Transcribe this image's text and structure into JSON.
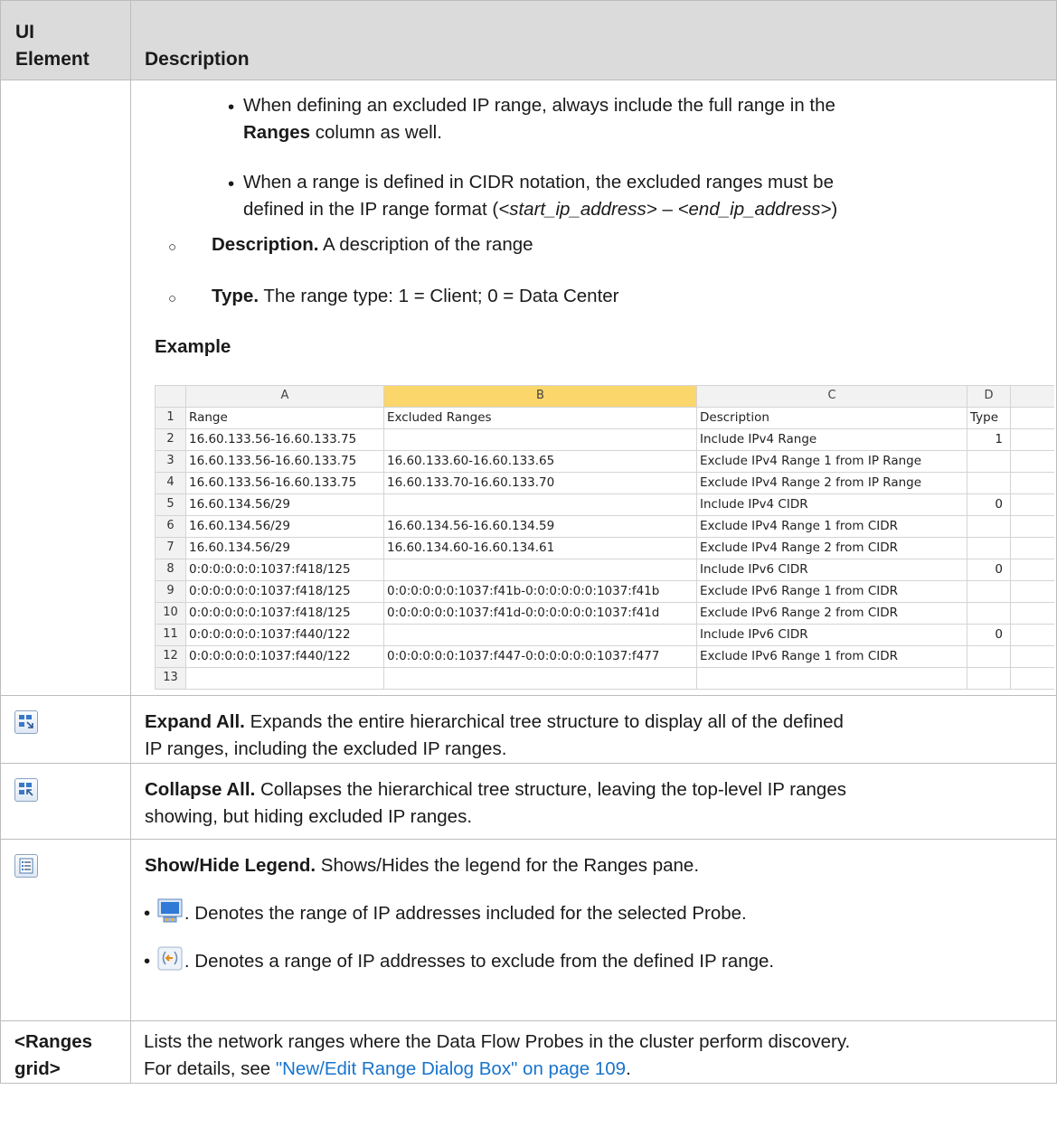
{
  "header": {
    "col1_line1": "UI",
    "col1_line2": "Element",
    "col2": "Description"
  },
  "row1": {
    "bullet1_text": "When defining an excluded IP range, always include the full range in the",
    "bullet1_bold": "Ranges",
    "bullet1_tail": "column as well.",
    "bullet2_line1": "When a range is defined in CIDR notation, the excluded ranges must be",
    "bullet2_pre": "defined in the IP range format (",
    "bullet2_start": "<start_ip_address>",
    "bullet2_dash": " – ",
    "bullet2_end": "<end_ip_address>",
    "bullet2_close": ")",
    "desc_bold": "Description.",
    "desc_text": "A description of the range",
    "type_bold": "Type.",
    "type_text": "The range type: 1 = Client; 0 = Data Center",
    "example_heading": "Example"
  },
  "sheet": {
    "col_headers": [
      "A",
      "B",
      "C",
      "D"
    ],
    "rows": [
      {
        "n": "1",
        "a": "Range",
        "b": "Excluded Ranges",
        "c": "Description",
        "d": "Type"
      },
      {
        "n": "2",
        "a": "16.60.133.56-16.60.133.75",
        "b": "",
        "c": "Include IPv4 Range",
        "d": "1"
      },
      {
        "n": "3",
        "a": "16.60.133.56-16.60.133.75",
        "b": "16.60.133.60-16.60.133.65",
        "c": "Exclude IPv4 Range 1 from IP Range",
        "d": ""
      },
      {
        "n": "4",
        "a": "16.60.133.56-16.60.133.75",
        "b": "16.60.133.70-16.60.133.70",
        "c": "Exclude IPv4 Range 2 from IP Range",
        "d": ""
      },
      {
        "n": "5",
        "a": "16.60.134.56/29",
        "b": "",
        "c": "Include IPv4 CIDR",
        "d": "0"
      },
      {
        "n": "6",
        "a": "16.60.134.56/29",
        "b": "16.60.134.56-16.60.134.59",
        "c": "Exclude IPv4 Range 1 from CIDR",
        "d": ""
      },
      {
        "n": "7",
        "a": "16.60.134.56/29",
        "b": "16.60.134.60-16.60.134.61",
        "c": "Exclude IPv4 Range 2 from CIDR",
        "d": ""
      },
      {
        "n": "8",
        "a": "0:0:0:0:0:0:1037:f418/125",
        "b": "",
        "c": "Include IPv6 CIDR",
        "d": "0"
      },
      {
        "n": "9",
        "a": "0:0:0:0:0:0:1037:f418/125",
        "b": "0:0:0:0:0:0:1037:f41b-0:0:0:0:0:0:1037:f41b",
        "c": "Exclude IPv6 Range 1 from CIDR",
        "d": ""
      },
      {
        "n": "10",
        "a": "0:0:0:0:0:0:1037:f418/125",
        "b": "0:0:0:0:0:0:1037:f41d-0:0:0:0:0:0:1037:f41d",
        "c": "Exclude IPv6 Range 2 from CIDR",
        "d": ""
      },
      {
        "n": "11",
        "a": "0:0:0:0:0:0:1037:f440/122",
        "b": "",
        "c": "Include IPv6 CIDR",
        "d": "0"
      },
      {
        "n": "12",
        "a": "0:0:0:0:0:0:1037:f440/122",
        "b": "0:0:0:0:0:0:1037:f447-0:0:0:0:0:0:1037:f477",
        "c": "Exclude IPv6 Range 1 from CIDR",
        "d": ""
      },
      {
        "n": "13",
        "a": "",
        "b": "",
        "c": "",
        "d": ""
      }
    ]
  },
  "expand": {
    "icon": "expand-all-icon",
    "bold": "Expand All.",
    "text1": "Expands the entire hierarchical tree structure to display all of the defined",
    "text2": "IP ranges, including the excluded IP ranges."
  },
  "collapse": {
    "icon": "collapse-all-icon",
    "bold": "Collapse All.",
    "text1": "Collapses the hierarchical tree structure, leaving the top-level IP ranges",
    "text2": "showing, but hiding excluded IP ranges."
  },
  "legend": {
    "icon": "show-hide-legend-icon",
    "bold": "Show/Hide Legend.",
    "text": "Shows/Hides the legend for the Ranges pane.",
    "item1": ". Denotes the range of IP addresses included for the selected Probe.",
    "item2": ". Denotes a range of IP addresses to exclude from the defined IP range."
  },
  "grid": {
    "label1": "<Ranges",
    "label2": "grid>",
    "text1": "Lists the network ranges where the Data Flow Probes in the cluster perform discovery.",
    "text2_pre": "For details, see ",
    "link": "\"New/Edit Range Dialog Box\" on page 109",
    "text2_post": "."
  },
  "colors": {
    "link": "#1874cd",
    "header_bg": "#dbdbdb",
    "selected_col": "#fbd66b"
  }
}
